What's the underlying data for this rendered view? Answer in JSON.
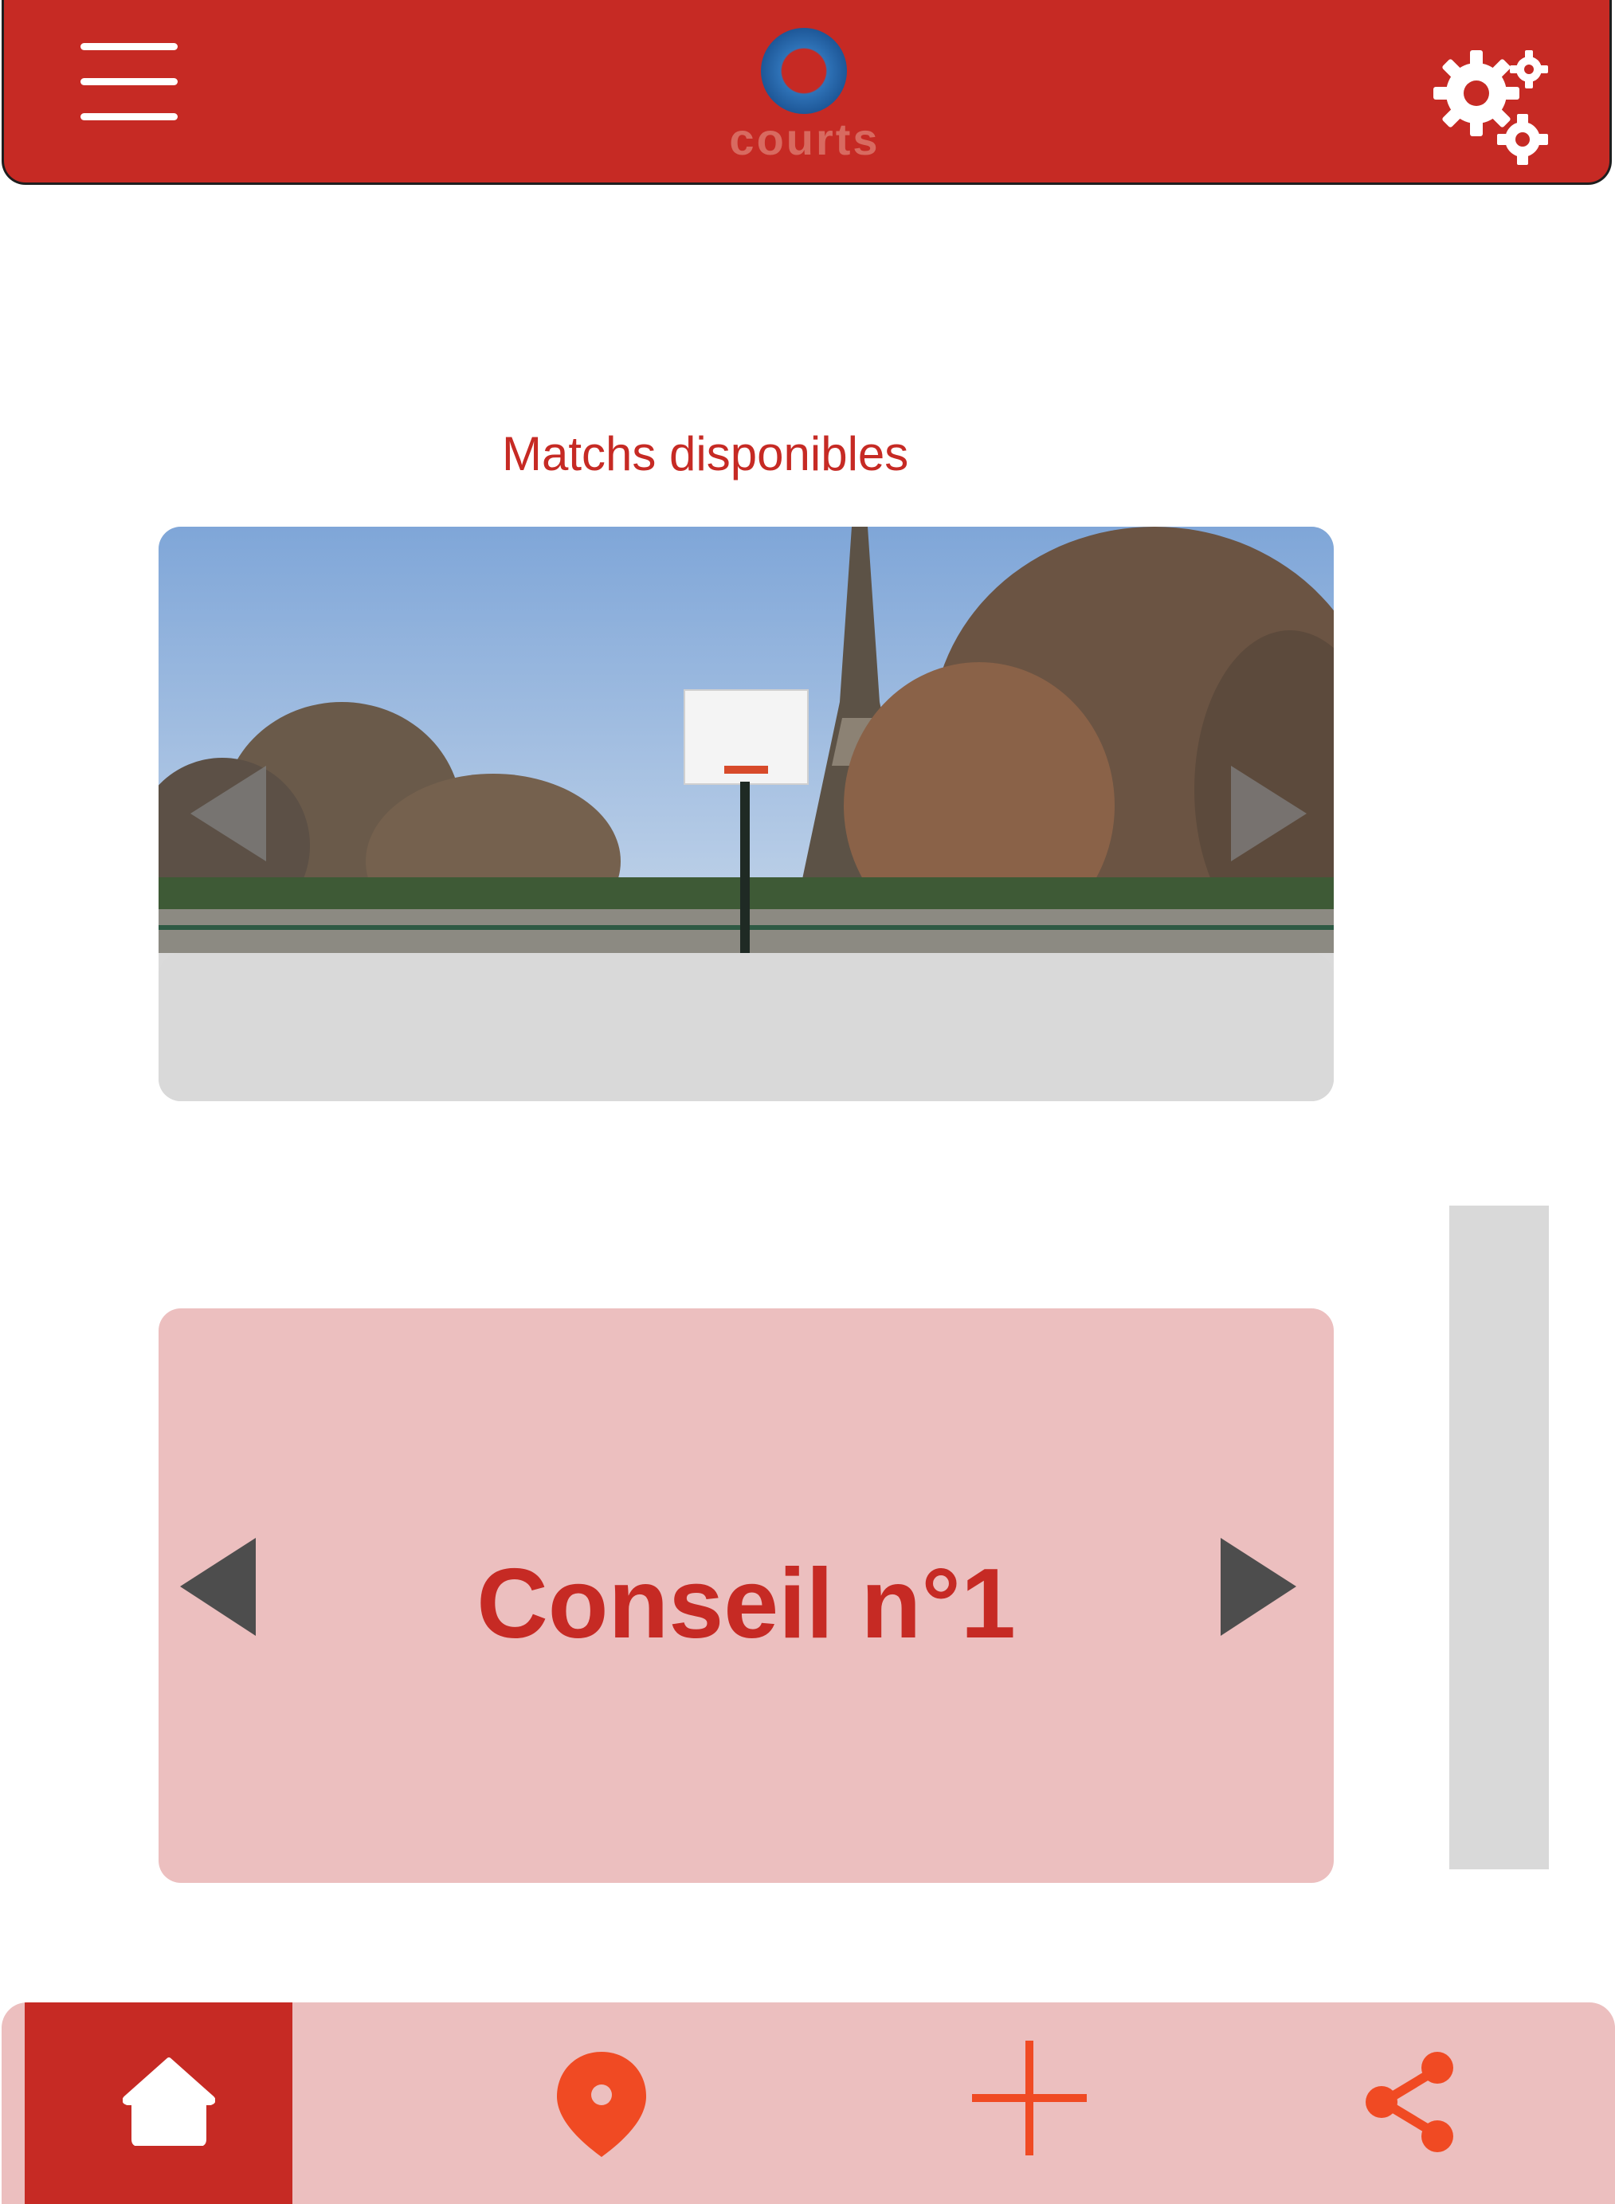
{
  "app": {
    "logo_text": "courts",
    "colors": {
      "primary": "#c62a24",
      "tip_bg": "#ecbfbf",
      "placeholder": "#d9d9d9",
      "nav_icon": "#f04a23"
    }
  },
  "header": {
    "menu_icon": "hamburger-menu-icon",
    "settings_icon": "gears-icon"
  },
  "main": {
    "matches_title": "Matchs disponibles",
    "match_carousel": {
      "prev_icon": "chevron-left-icon",
      "next_icon": "chevron-right-icon"
    },
    "tip_carousel": {
      "title": "Conseil n°1",
      "prev_icon": "chevron-left-icon",
      "next_icon": "chevron-right-icon"
    }
  },
  "bottom_nav": {
    "items": [
      {
        "icon": "home-icon",
        "active": true
      },
      {
        "icon": "map-pin-icon",
        "active": false
      },
      {
        "icon": "plus-icon",
        "active": false
      },
      {
        "icon": "share-icon",
        "active": false
      }
    ]
  }
}
